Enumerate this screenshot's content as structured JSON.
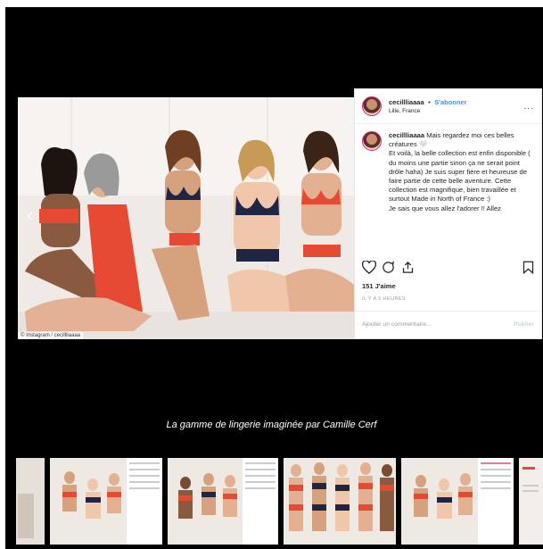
{
  "post": {
    "username": "cecillliaaaa",
    "separator": "•",
    "follow_label": "S'abonner",
    "location": "Lille, France",
    "more_label": "...",
    "caption_user": "cecillliaaaa",
    "caption_text": "Mais regardez moi ces belles créatures",
    "caption_heart": "🤍",
    "caption_body": "Et voilà, la belle collection est enfin disponible ( du moins une partie sinon ça ne serait point drôle haha) Je suis super fière et heureuse de faire partie de cette belle aventure. Cette collection est magnifique, bien travaillée et surtout Made in North of France :)",
    "caption_last": "Je sais que vous allez l'adorer !! Allez",
    "likes": "151 J'aime",
    "time_ago": "IL Y A 5 HEURES",
    "comment_placeholder": "Ajouter un commentaire...",
    "post_button": "Publier"
  },
  "photo_credit": "© Instagram / cecillliaaaa",
  "viewer": {
    "prev_arrow": "‹",
    "next_arrow": "›",
    "caption": "La gamme de lingerie imaginée par Camille Cerf"
  },
  "colors": {
    "background": "#000000",
    "link_blue": "#3897f0",
    "lingerie_red": "#e64a33",
    "lingerie_navy": "#1f2545"
  },
  "icons": [
    "heart-icon",
    "comment-icon",
    "share-icon",
    "bookmark-icon"
  ]
}
